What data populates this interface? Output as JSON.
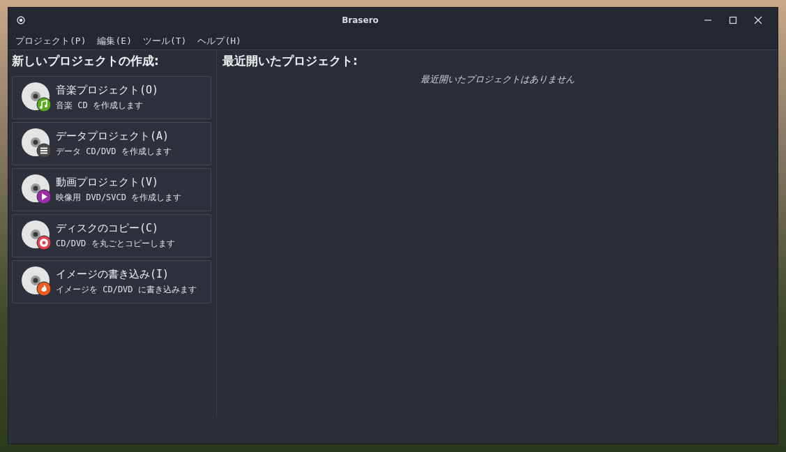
{
  "window": {
    "title": "Brasero"
  },
  "menu": [
    "プロジェクト(P)",
    "編集(E)",
    "ツール(T)",
    "ヘルプ(H)"
  ],
  "new_project": {
    "heading": "新しいプロジェクトの作成:",
    "items": [
      {
        "kind": "music",
        "title": "音楽プロジェクト(O)",
        "description": "音楽 CD を作成します"
      },
      {
        "kind": "data",
        "title": "データプロジェクト(A)",
        "description": "データ CD/DVD を作成します"
      },
      {
        "kind": "video",
        "title": "動画プロジェクト(V)",
        "description": "映像用 DVD/SVCD を作成します"
      },
      {
        "kind": "copy",
        "title": "ディスクのコピー(C)",
        "description": "CD/DVD を丸ごとコピーします"
      },
      {
        "kind": "burn",
        "title": "イメージの書き込み(I)",
        "description": "イメージを CD/DVD に書き込みます"
      }
    ]
  },
  "recent": {
    "heading": "最近開いたプロジェクト:",
    "empty_message": "最近開いたプロジェクトはありません"
  }
}
